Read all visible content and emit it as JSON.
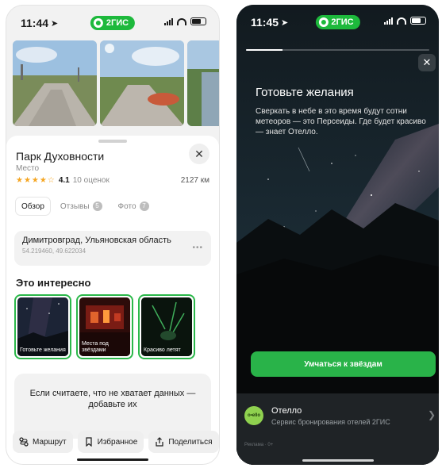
{
  "left": {
    "status": {
      "time": "11:44",
      "brand": "2ГИС"
    },
    "place": {
      "title": "Парк Духовности",
      "type": "Место",
      "stars": "★★★★☆",
      "rating": "4.1",
      "reviews": "10 оценок",
      "distance": "2127 км"
    },
    "tabs": [
      {
        "label": "Обзор"
      },
      {
        "label": "Отзывы",
        "badge": "5"
      },
      {
        "label": "Фото",
        "badge": "7"
      }
    ],
    "address": {
      "line": "Димитровград, Ульяновская область",
      "coords": "54.219460, 49.622034"
    },
    "interesting": {
      "title": "Это интересно",
      "items": [
        {
          "label": "Готовьте желания"
        },
        {
          "label": "Места под звёздами"
        },
        {
          "label": "Красиво летят"
        }
      ]
    },
    "missing_data": "Если считаете, что не хватает данных — добавьте их",
    "actions": [
      {
        "label": "Маршрут",
        "icon": "route-icon"
      },
      {
        "label": "Избранное",
        "icon": "bookmark-icon"
      },
      {
        "label": "Поделиться",
        "icon": "share-icon"
      }
    ]
  },
  "right": {
    "status": {
      "time": "11:45",
      "brand": "2ГИС"
    },
    "story": {
      "progress": 0.2,
      "heading": "Готовьте желания",
      "text": "Сверкать в небе в это время будут сотни метеоров — это Персеиды. Где будет красиво — знает Отелло.",
      "cta": "Умчаться к звёздам"
    },
    "ad": {
      "logo": "otello",
      "name": "Отелло",
      "subtitle": "Сервис бронирования отелей 2ГИС",
      "label": "Реклама · 0+"
    }
  }
}
